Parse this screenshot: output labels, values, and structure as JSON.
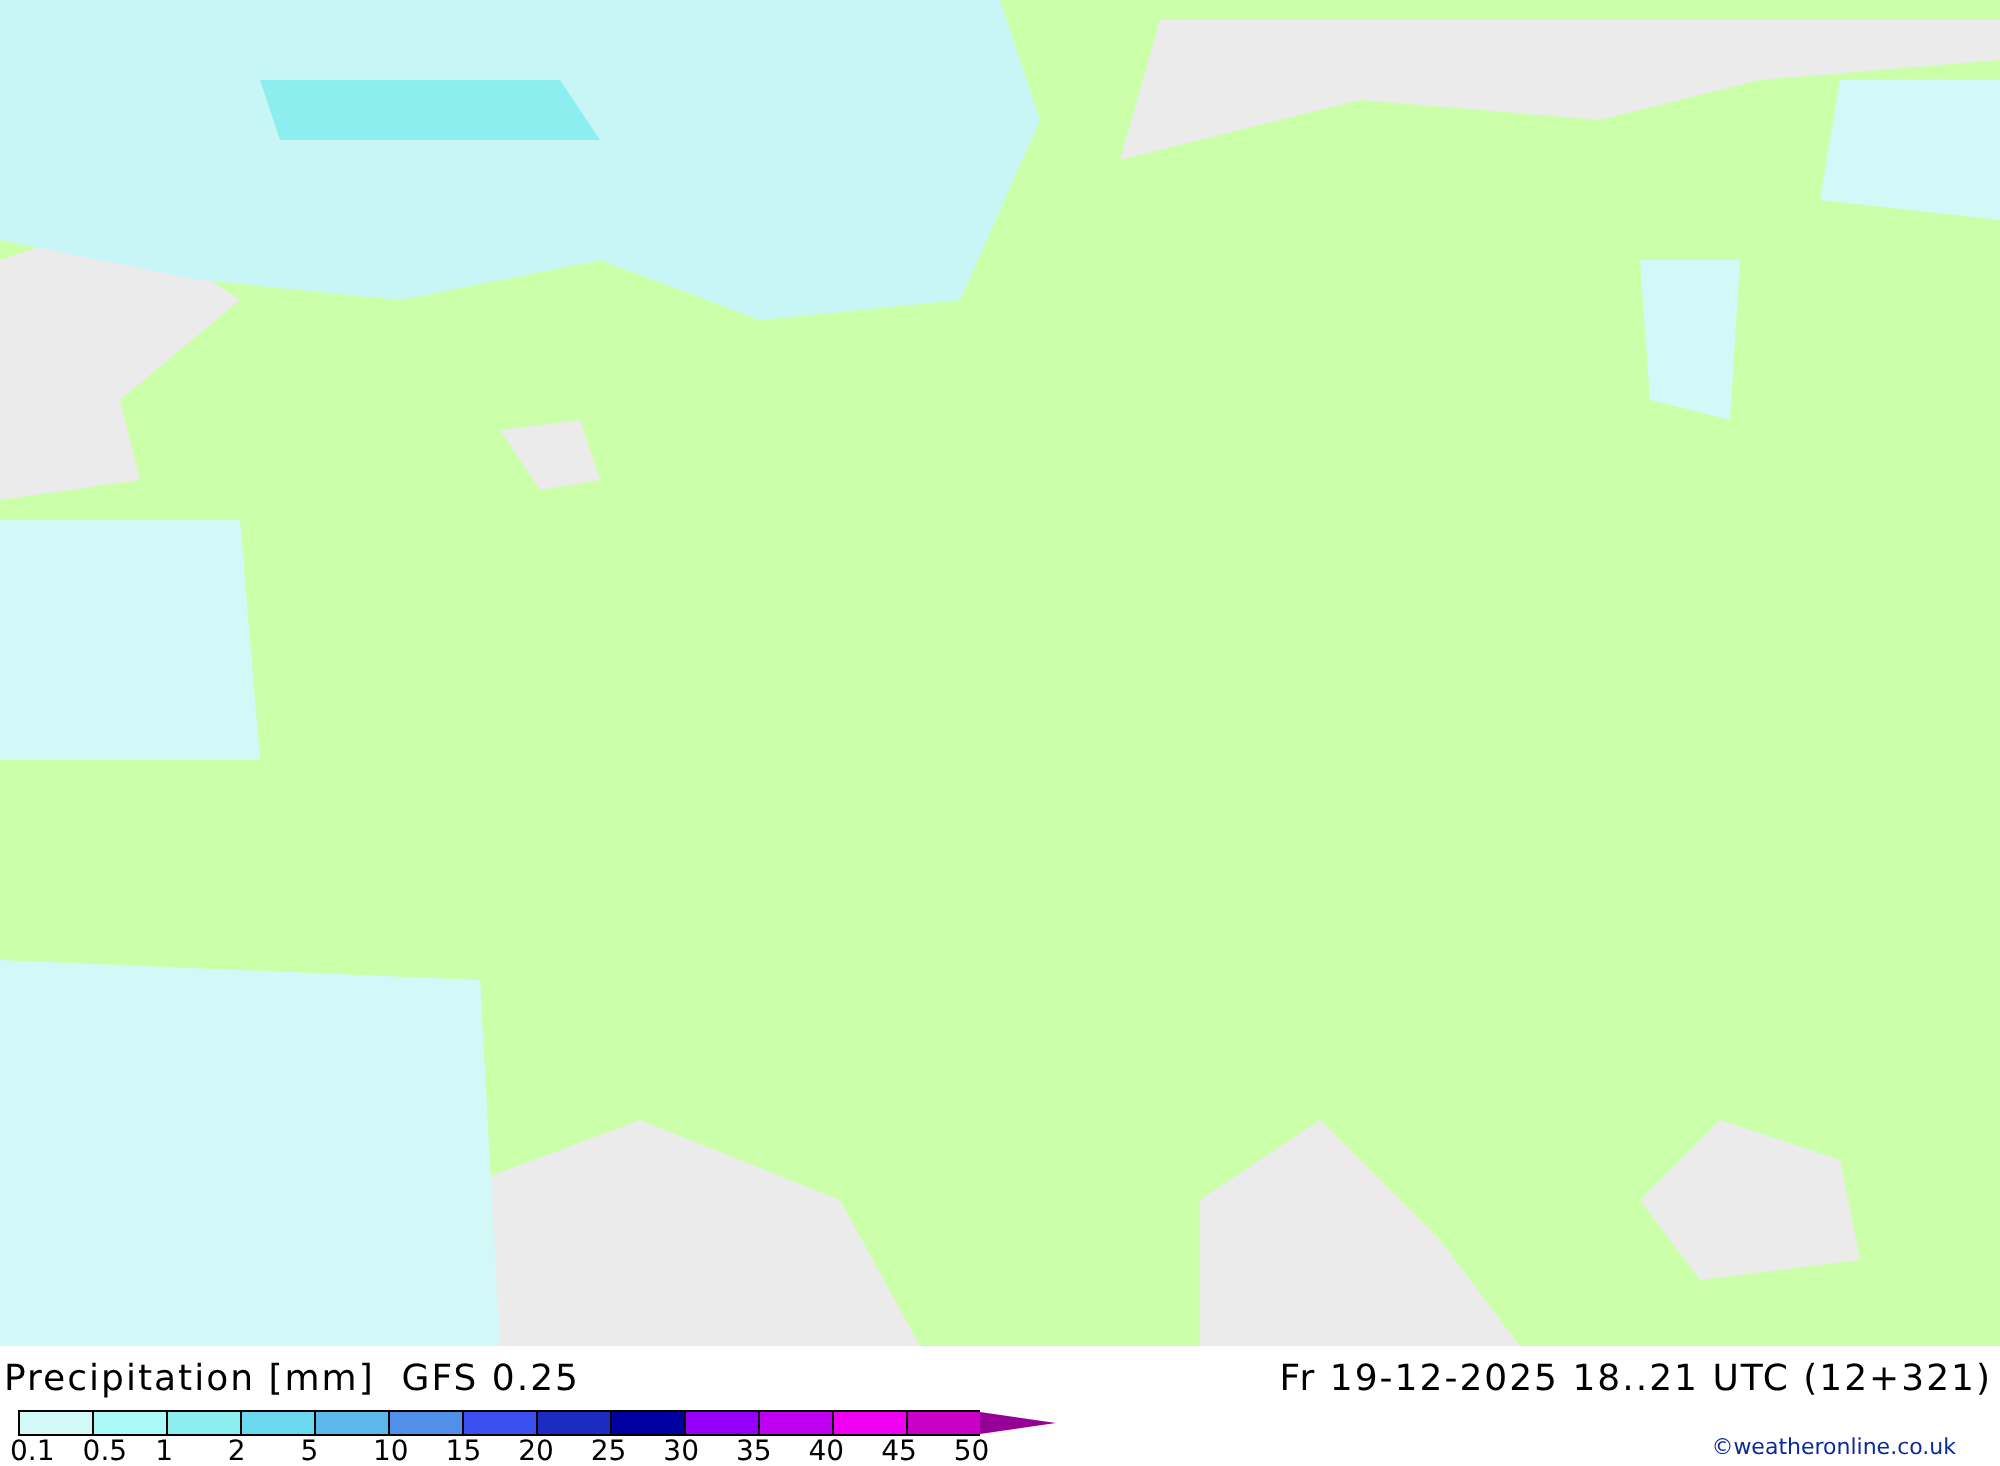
{
  "title": "Precipitation [mm]  GFS 0.25",
  "valid_time": "Fr 19-12-2025 18..21 UTC (12+321)",
  "credit": "©weatheronline.co.uk",
  "legend": {
    "steps": [
      {
        "color": "#d2f8f8"
      },
      {
        "color": "#aafafa"
      },
      {
        "color": "#8ceeee"
      },
      {
        "color": "#6ad8ee"
      },
      {
        "color": "#5cb8ea"
      },
      {
        "color": "#5090e8"
      },
      {
        "color": "#3a50f0"
      },
      {
        "color": "#1c2cc0"
      },
      {
        "color": "#0000a0"
      },
      {
        "color": "#9600fa"
      },
      {
        "color": "#be00f0"
      },
      {
        "color": "#f000f0"
      },
      {
        "color": "#c800c8"
      }
    ],
    "labels": [
      "0.1",
      "0.5",
      "1",
      "2",
      "5",
      "10",
      "15",
      "20",
      "25",
      "30",
      "35",
      "40",
      "45",
      "50"
    ]
  }
}
